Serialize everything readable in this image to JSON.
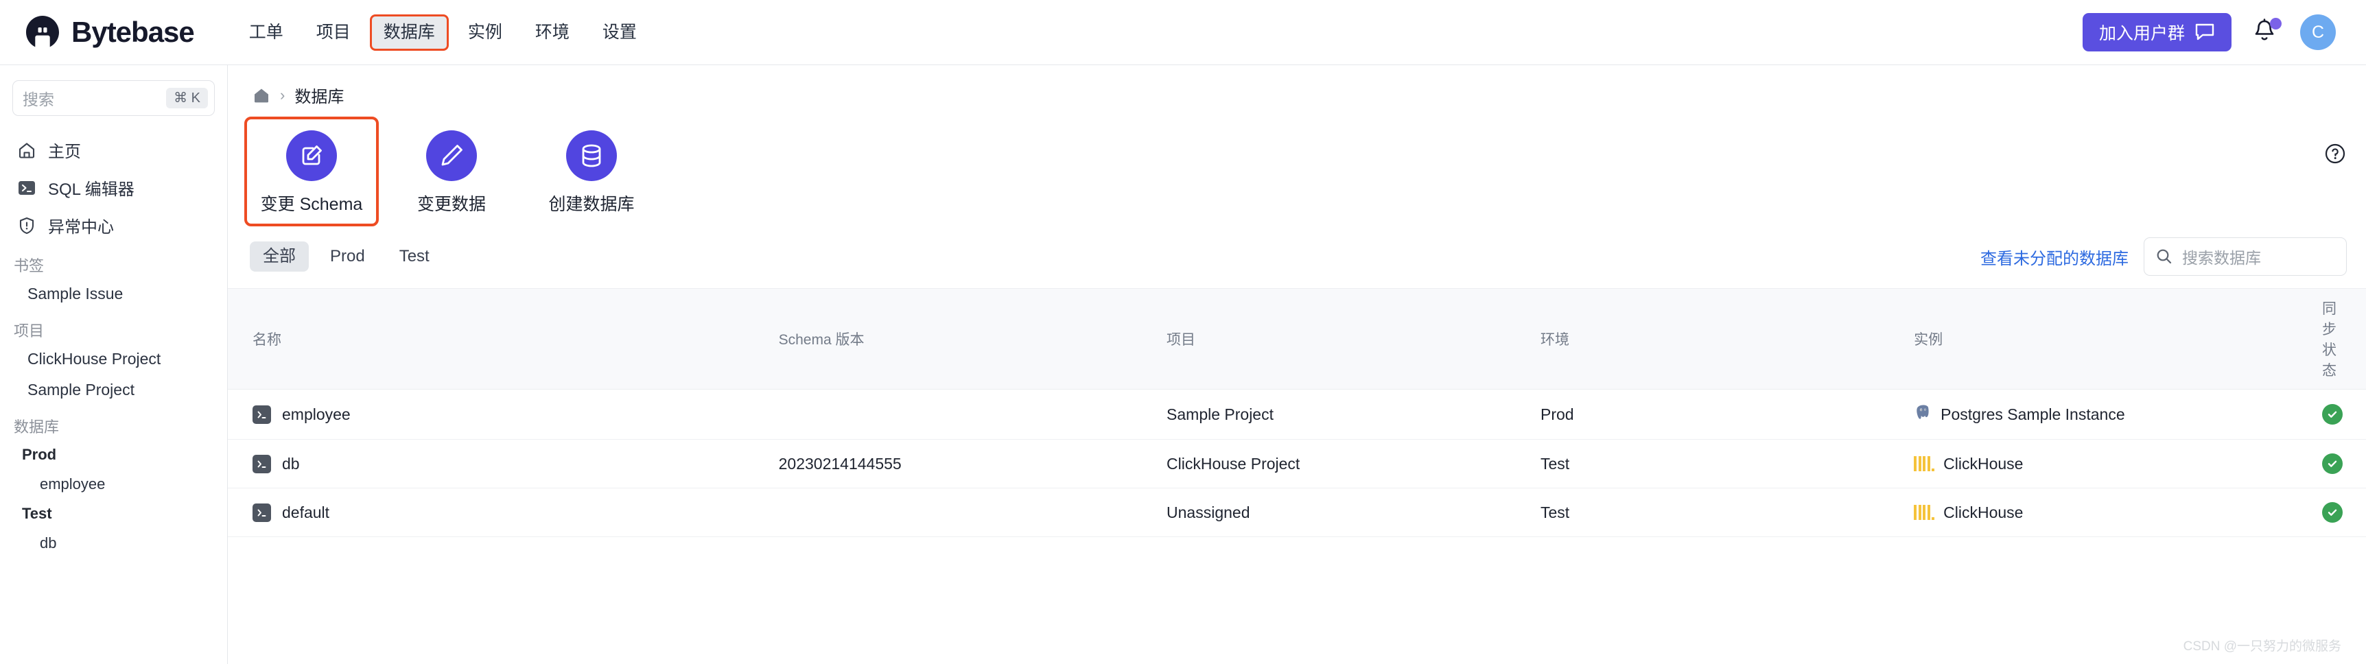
{
  "app": {
    "brand": "Bytebase",
    "nav": [
      {
        "label": "工单",
        "state": "normal"
      },
      {
        "label": "项目",
        "state": "normal"
      },
      {
        "label": "数据库",
        "state": "highlight"
      },
      {
        "label": "实例",
        "state": "normal"
      },
      {
        "label": "环境",
        "state": "normal"
      },
      {
        "label": "设置",
        "state": "normal"
      }
    ],
    "join_button": "加入用户群",
    "avatar_initial": "C",
    "accent_purple": "#5145e0",
    "highlight_red": "#ee4c23",
    "link_blue": "#2d6ae0",
    "status_green": "#3aa255"
  },
  "sidebar": {
    "search": {
      "placeholder": "搜索",
      "shortcut": "⌘ K"
    },
    "items": [
      {
        "label": "主页",
        "icon": "home-icon"
      },
      {
        "label": "SQL 编辑器",
        "icon": "terminal-icon"
      },
      {
        "label": "异常中心",
        "icon": "shield-alert-icon"
      }
    ],
    "bookmarks": {
      "title": "书签",
      "items": [
        "Sample Issue"
      ]
    },
    "projects": {
      "title": "项目",
      "items": [
        "ClickHouse Project",
        "Sample Project"
      ]
    },
    "databases": {
      "title": "数据库",
      "groups": [
        {
          "env": "Prod",
          "items": [
            "employee"
          ]
        },
        {
          "env": "Test",
          "items": [
            "db"
          ]
        }
      ]
    }
  },
  "main": {
    "breadcrumb": {
      "home_icon": "home-icon",
      "separator": "›",
      "current": "数据库"
    },
    "cards": [
      {
        "label": "变更 Schema",
        "icon": "edit-square-icon",
        "state": "highlight"
      },
      {
        "label": "变更数据",
        "icon": "pencil-icon",
        "state": "normal"
      },
      {
        "label": "创建数据库",
        "icon": "database-icon",
        "state": "normal"
      }
    ],
    "filters": {
      "tabs": [
        {
          "label": "全部",
          "active": true
        },
        {
          "label": "Prod",
          "active": false
        },
        {
          "label": "Test",
          "active": false
        }
      ],
      "unassigned_link": "查看未分配的数据库",
      "search_placeholder": "搜索数据库"
    },
    "table": {
      "columns": [
        "名称",
        "Schema 版本",
        "项目",
        "环境",
        "实例",
        "同步状态"
      ],
      "rows": [
        {
          "name": "employee",
          "schema_version": "",
          "project": "Sample Project",
          "environment": "Prod",
          "instance": "Postgres Sample Instance",
          "instance_icon": "postgres-icon",
          "sync_status": "ok"
        },
        {
          "name": "db",
          "schema_version": "20230214144555",
          "project": "ClickHouse Project",
          "environment": "Test",
          "instance": "ClickHouse",
          "instance_icon": "clickhouse-icon",
          "sync_status": "ok"
        },
        {
          "name": "default",
          "schema_version": "",
          "project": "Unassigned",
          "environment": "Test",
          "instance": "ClickHouse",
          "instance_icon": "clickhouse-icon",
          "sync_status": "ok"
        }
      ]
    },
    "watermark": "CSDN @一只努力的微服务"
  }
}
